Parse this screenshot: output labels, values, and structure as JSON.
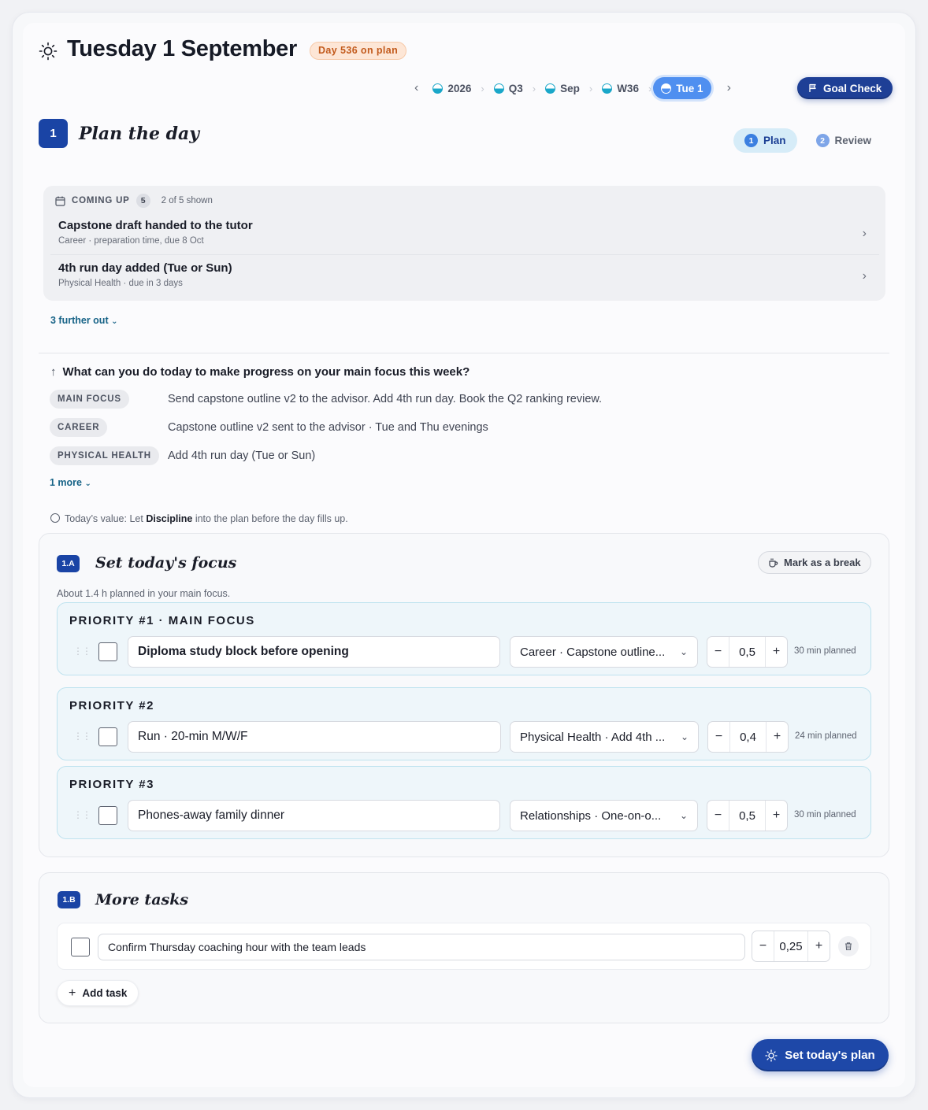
{
  "header": {
    "title": "Tuesday 1 September",
    "day_badge": "Day 536 on plan"
  },
  "breadcrumb": {
    "items": [
      {
        "label": "2026"
      },
      {
        "label": "Q3"
      },
      {
        "label": "Sep"
      },
      {
        "label": "W36"
      },
      {
        "label": "Tue 1",
        "active": true
      }
    ],
    "goal_check": "Goal Check"
  },
  "section": {
    "number": "1",
    "title": "Plan the day",
    "tabs": [
      {
        "num": "1",
        "label": "Plan",
        "active": true
      },
      {
        "num": "2",
        "label": "Review",
        "active": false
      }
    ]
  },
  "coming_up": {
    "heading": "COMING UP",
    "count": "5",
    "shown": "2 of 5 shown",
    "items": [
      {
        "title": "Capstone draft handed to the tutor",
        "sub": "Career · preparation time, due 8 Oct"
      },
      {
        "title": "4th run day added (Tue or Sun)",
        "sub": "Physical Health · due in 3 days"
      }
    ],
    "further": "3 further out"
  },
  "focus_prompt": {
    "question": "What can you do today to make progress on your main focus this week?",
    "rows": [
      {
        "tag": "MAIN FOCUS",
        "text": "Send capstone outline v2 to the advisor. Add 4th run day. Book the Q2 ranking review."
      },
      {
        "tag": "CAREER",
        "text": "Capstone outline v2 sent to the advisor · Tue and Thu evenings"
      },
      {
        "tag": "PHYSICAL HEALTH",
        "text": "Add 4th run day (Tue or Sun)"
      }
    ],
    "more": "1 more",
    "value_prefix": "Today’s value: Let ",
    "value_word": "Discipline",
    "value_suffix": " into the plan before the day fills up."
  },
  "focus_section": {
    "number": "1.A",
    "title": "Set today's focus",
    "break_button": "Mark as a break",
    "subtitle": "About 1.4 h planned in your main focus.",
    "priorities": [
      {
        "label": "PRIORITY #1 · MAIN FOCUS",
        "task": "Diploma study block before opening",
        "area": "Career · Capstone outline...",
        "hours": "0,5",
        "planned": "30 min planned"
      },
      {
        "label": "PRIORITY #2",
        "task": "Run · 20-min M/W/F",
        "area": "Physical Health · Add 4th ...",
        "hours": "0,4",
        "planned": "24 min planned"
      },
      {
        "label": "PRIORITY #3",
        "task": "Phones-away family dinner",
        "area": "Relationships · One-on-o...",
        "hours": "0,5",
        "planned": "30 min planned"
      }
    ]
  },
  "more_tasks": {
    "number": "1.B",
    "title": "More tasks",
    "tasks": [
      {
        "task": "Confirm Thursday coaching hour with the team leads",
        "hours": "0,25"
      }
    ],
    "add_label": "Add task"
  },
  "cta": {
    "label": "Set today's plan"
  },
  "colors": {
    "primary": "#1a44a5",
    "accent_active": "#4f8ff0",
    "badge_bg": "#fde6d6",
    "badge_text": "#c25a1c"
  }
}
